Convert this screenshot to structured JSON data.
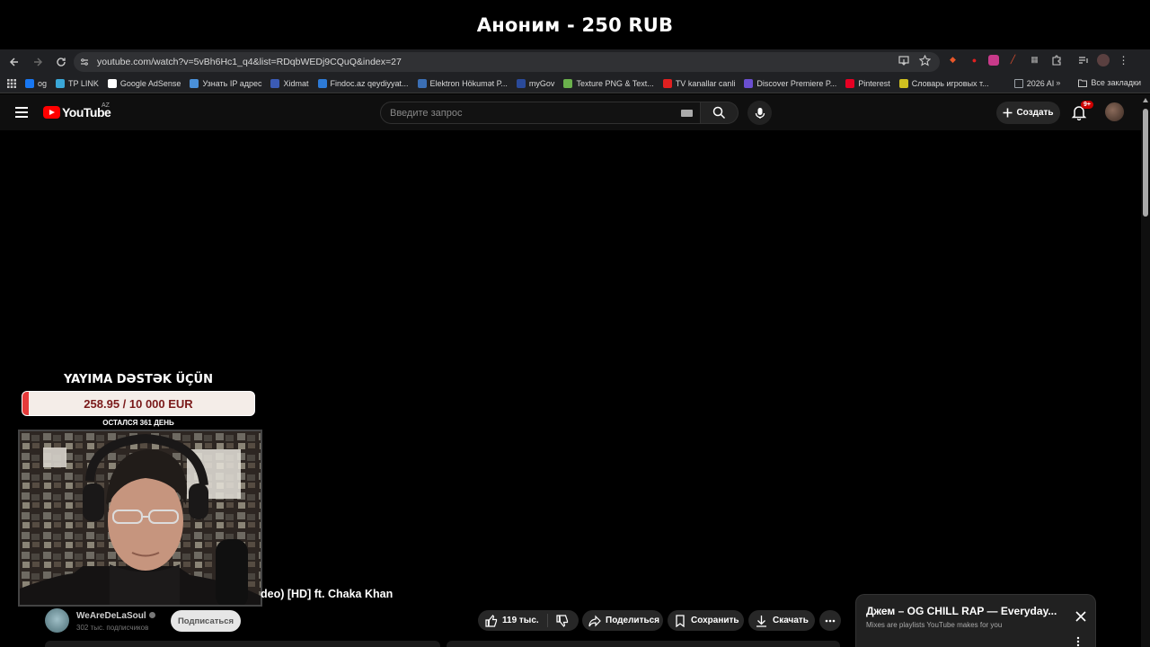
{
  "stream_overlay": {
    "top_banner": "Аноним - 250 RUB",
    "donation_header": "YAYIMA DƏSTƏK ÜÇÜN",
    "goal_text": "258.95 / 10 000 EUR",
    "goal_progress_fraction": 0.026,
    "days_left": "ОСТАЛСЯ 361 ДЕНЬ"
  },
  "browser": {
    "url": "youtube.com/watch?v=5vBh6Hc1_q4&list=RDqbWEDj9CQuQ&index=27",
    "bookmarks": [
      {
        "label": "og",
        "color": "#1877f2"
      },
      {
        "label": "TP LINK",
        "color": "#3aa7d8"
      },
      {
        "label": "Google AdSense",
        "color": "#ffffff"
      },
      {
        "label": "Узнать IP адрес",
        "color": "#4a90d9"
      },
      {
        "label": "Xidmat",
        "color": "#3b5bb5"
      },
      {
        "label": "Findoc.az qeydiyyat...",
        "color": "#2d7ad6"
      },
      {
        "label": "Elektron Hökumət P...",
        "color": "#3b6fb5"
      },
      {
        "label": "myGov",
        "color": "#2a4a9a"
      },
      {
        "label": "Texture PNG & Text...",
        "color": "#6ab04c"
      },
      {
        "label": "TV kanallar canli",
        "color": "#e02020"
      },
      {
        "label": "Discover Premiere P...",
        "color": "#6b4fd0"
      },
      {
        "label": "Pinterest",
        "color": "#e60023"
      },
      {
        "label": "Словарь игровых т...",
        "color": "#d0c020"
      },
      {
        "label": "2026 AI",
        "color": "#9aa0a6"
      }
    ],
    "all_bookmarks": "Все закладки"
  },
  "youtube": {
    "logo_text": "YouTube",
    "country_code": "AZ",
    "search_placeholder": "Введите запрос",
    "create_label": "Создать",
    "notifications_badge": "9+",
    "video_title_visible": "deo) [HD] ft. Chaka Khan",
    "channel_name": "WeAreDeLaSoul",
    "channel_subs": "302 тыс. подписчиков",
    "subscribe_label": "Подписаться",
    "likes": "119 тыс.",
    "share_label": "Поделиться",
    "save_label": "Сохранить",
    "download_label": "Скачать",
    "mix_title": "Джем – OG CHILL RAP — Everyday...",
    "mix_subtitle": "Mixes are playlists YouTube makes for you"
  }
}
